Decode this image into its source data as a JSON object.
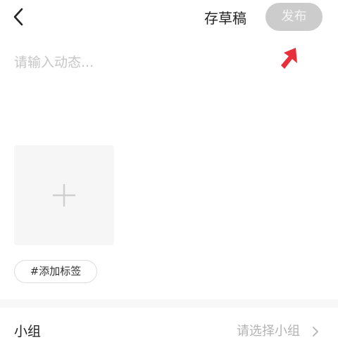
{
  "header": {
    "back_icon": "chevron-left-icon",
    "save_draft_label": "存草稿",
    "publish_label": "发布"
  },
  "editor": {
    "placeholder": "请输入动态...",
    "value": ""
  },
  "media": {
    "add_icon": "plus-icon"
  },
  "tags": {
    "add_tag_label": "#添加标签"
  },
  "group": {
    "label": "小组",
    "placeholder": "请选择小组",
    "chevron_icon": "chevron-right-icon"
  },
  "annotation": {
    "icon": "red-arrow-icon",
    "color": "#e8303a"
  },
  "colors": {
    "publish_bg": "#cccccc",
    "publish_text": "#f4f4f4",
    "placeholder": "#c6c6c6",
    "divider": "#f7f7f7"
  }
}
